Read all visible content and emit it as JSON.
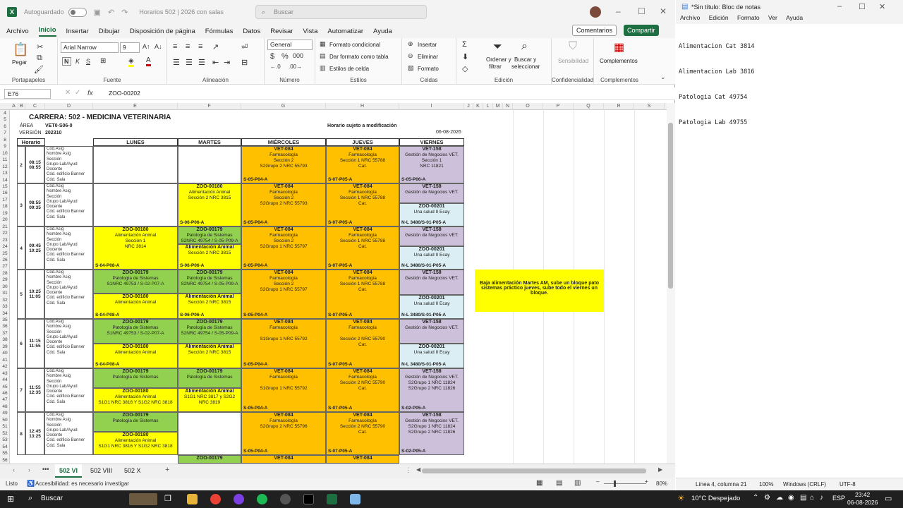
{
  "excel": {
    "autosave_label": "Autoguardado",
    "doc_title": "Horarios 502 | 2026 con salas",
    "search_placeholder": "Buscar",
    "menu": [
      "Archivo",
      "Inicio",
      "Insertar",
      "Dibujar",
      "Disposición de página",
      "Fórmulas",
      "Datos",
      "Revisar",
      "Vista",
      "Automatizar",
      "Ayuda"
    ],
    "comments_label": "Comentarios",
    "share_label": "Compartir",
    "ribbon": {
      "paste": "Pegar",
      "font_name": "Arial Narrow",
      "font_size": "9",
      "number_format": "General",
      "cond_format": "Formato condicional",
      "table_format": "Dar formato como tabla",
      "cell_styles": "Estilos de celda",
      "insert": "Insertar",
      "delete": "Eliminar",
      "format": "Formato",
      "sort_filter_1": "Ordenar y",
      "sort_filter_2": "filtrar",
      "find_1": "Buscar y",
      "find_2": "seleccionar",
      "sensitivity": "Sensibilidad",
      "addins": "Complementos",
      "groups": [
        "Portapapeles",
        "Fuente",
        "Alineación",
        "Número",
        "Estilos",
        "Celdas",
        "Edición",
        "Confidencialidad",
        "Complementos"
      ]
    },
    "namebox": "E76",
    "formula": "ZOO-00202",
    "columns": [
      "A",
      "B",
      "C",
      "D",
      "E",
      "F",
      "G",
      "H",
      "I",
      "J",
      "K",
      "L",
      "M",
      "N",
      "O",
      "P",
      "Q",
      "R",
      "S"
    ],
    "rows": [
      "4",
      "5",
      "6",
      "7",
      "8",
      "9",
      "10",
      "11",
      "12",
      "13",
      "14",
      "15",
      "16",
      "17",
      "18",
      "19",
      "20",
      "21",
      "22",
      "23",
      "24",
      "25",
      "26",
      "27",
      "28",
      "29",
      "30",
      "31",
      "32",
      "33",
      "34",
      "35",
      "36",
      "37",
      "38",
      "39",
      "40",
      "41",
      "42",
      "43",
      "44",
      "45",
      "46",
      "47",
      "48",
      "49",
      "50",
      "51",
      "52",
      "53",
      "54",
      "55",
      "56"
    ],
    "sheet": {
      "title": "CARRERA: 502 - MEDICINA VETERINARIA",
      "area_label": "ÁREA",
      "area_value": "VET0-S06-0",
      "version_label": "VERSIÓN",
      "version_value": "202310",
      "notice": "Horario sujeto a modificación",
      "date": "06-08-2026",
      "headers": [
        "Horario",
        "LUNES",
        "MARTES",
        "MIÉRCOLES",
        "JUEVES",
        "VIERNES"
      ],
      "row_labels": [
        "Cód.Asig",
        "Nombre Asig",
        "Sección",
        "Grupo Lab/Ayud",
        "Docente",
        "Cód. edificio Banner",
        "Cód. Sala"
      ],
      "blocks": [
        {
          "num": "2",
          "t1": "08:15",
          "t2": "08:55"
        },
        {
          "num": "3",
          "t1": "08:55",
          "t2": "09:35"
        },
        {
          "num": "4",
          "t1": "09:45",
          "t2": "10:25"
        },
        {
          "num": "5",
          "t1": "10:25",
          "t2": "11:05"
        },
        {
          "num": "6",
          "t1": "11:15",
          "t2": "11:55"
        },
        {
          "num": "7",
          "t1": "11:55",
          "t2": "12:35"
        },
        {
          "num": "8",
          "t1": "12:45",
          "t2": "13:25"
        }
      ],
      "cells": {
        "vet084": "VET-084",
        "farmaco": "Farmacología",
        "wed_b2": "Sección 2",
        "wed_b2n": "S2Grupo 2 NRC 55793",
        "wed_room": "S-05-P04-A",
        "thu_b2": "Sección 1 NRC 55788",
        "thu_room": "S-07-P05-A",
        "cat": "Cat.",
        "vet158": "VET-158",
        "gestion": "Gestión de Negocios VET.",
        "fri_s1": "Sección 1",
        "fri_nrc": "NRC 11821",
        "fri_room": "S-05-P06-A",
        "zoo180": "ZOO-00180",
        "alim": "Alimentación Animal",
        "alim_sec": "Sección 2 NRC 3815",
        "tue_room": "S-06-P06-A",
        "zoo201": "ZOO-00201",
        "unasalud": "Una salud II Ecay",
        "fri_room2": "N-L 3480/S-01-P05-A",
        "zoo179": "ZOO-00179",
        "patsist": "Patología de Sistemas",
        "pat_sec": "S2NRC 49754 / S-05-P09-A",
        "mon_alim_sec": "Sección 1",
        "mon_alim_nrc": "NRC 3814",
        "mon_room": "S-04-P08-A",
        "pat_mon_sec": "S1NRC 49753 / S-02-P07-A",
        "wed_b5": "Sección 2",
        "wed_b5n": "S2Grupo 1 NRC 55797",
        "wed_b6n": "S1Grupo 1 NRC 55792",
        "thu_b6n": "Sección 2 NRC 55790",
        "fri_b7n": "S2Grupo 1 NRC 11824",
        "fri_b7n2": "S2Grupo 2 NRC 11826",
        "fri_room3": "S-02-P05-A",
        "mon_alim_b7": "S1G1 NRC 3816 Y S1G2 NRC 3818",
        "tue_alim_b7": "S1G1 NRC 3817 y S2G2 NRC 3819",
        "wed_b8n": "S2Grupo 2 NRC 55796"
      }
    },
    "note": "Baja alimentación Martes AM, sube un bloque pato sistemas práctico jueves, sube todo el viernes un bloque.",
    "tabs": [
      "502 VI",
      "502 VIII",
      "502 X"
    ],
    "status": "Listo",
    "accessibility": "Accesibilidad: es necesario investigar",
    "zoom": "80%"
  },
  "notepad": {
    "title": "*Sin título: Bloc de notas",
    "menu": [
      "Archivo",
      "Edición",
      "Formato",
      "Ver",
      "Ayuda"
    ],
    "lines": [
      "Alimentacion Cat 3814",
      "Alimentacion Lab 3816",
      "Patologia Cat 49754",
      "Patologia Lab 49755"
    ],
    "status_pos": "Línea 4, columna 21",
    "status_zoom": "100%",
    "status_eol": "Windows (CRLF)",
    "status_enc": "UTF-8"
  },
  "taskbar": {
    "search": "Buscar",
    "weather": "10°C Despejado",
    "lang": "ESP",
    "time": "23:42",
    "date": "06-08-2026"
  }
}
